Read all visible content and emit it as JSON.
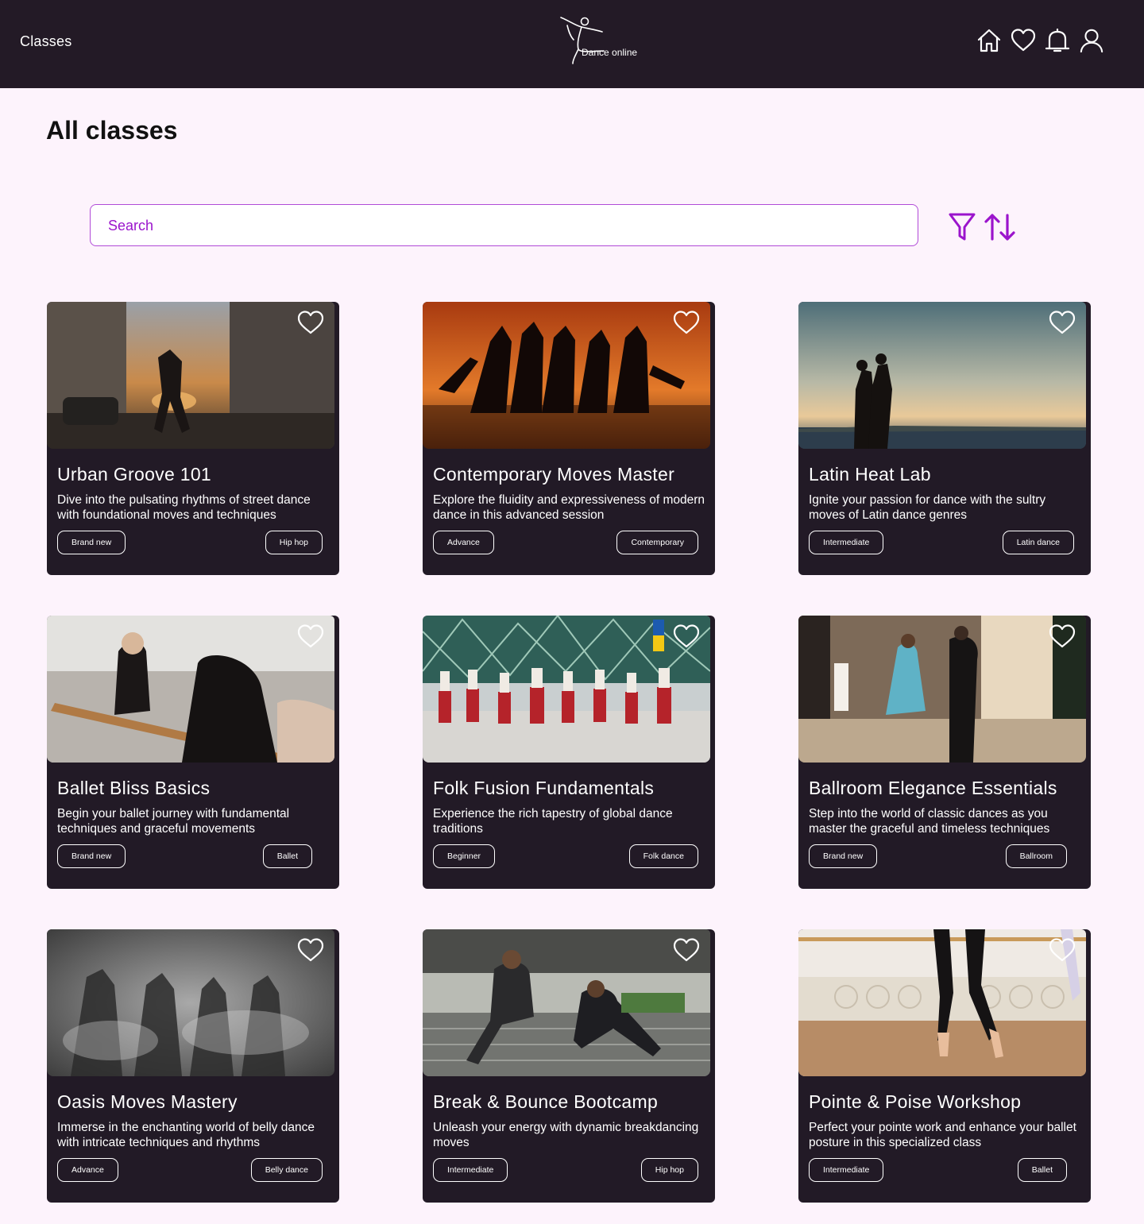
{
  "header": {
    "nav_title": "Classes",
    "brand": "Dance online",
    "icons": [
      "home-icon",
      "heart-icon",
      "bell-icon",
      "user-icon"
    ]
  },
  "page": {
    "title": "All classes"
  },
  "search": {
    "placeholder": "Search",
    "value": ""
  },
  "colors": {
    "topbar": "#231a26",
    "page_bg": "#fdf3fc",
    "card_bg": "#221a26",
    "accent": "#9b14cc"
  },
  "classes": [
    {
      "title": "Urban Groove 101",
      "description": "Dive into the pulsating rhythms of street dance with foundational moves and techniques",
      "level": "Brand new",
      "style": "Hip hop",
      "image": "street-dancer-city-sunset"
    },
    {
      "title": "Contemporary Moves Master",
      "description": "Explore the fluidity and expressiveness of modern dance in this advanced session",
      "level": "Advance",
      "style": "Contemporary",
      "image": "dancers-silhouette-orange"
    },
    {
      "title": "Latin Heat Lab",
      "description": "Ignite your passion for dance with the sultry moves of Latin dance genres",
      "level": "Intermediate",
      "style": "Latin dance",
      "image": "couple-dancing-waterfront"
    },
    {
      "title": "Ballet Bliss Basics",
      "description": "Begin your ballet journey with fundamental techniques and graceful movements",
      "level": "Brand new",
      "style": "Ballet",
      "image": "ballet-barre-class"
    },
    {
      "title": "Folk Fusion Fundamentals",
      "description": "Experience the rich tapestry of global dance traditions",
      "level": "Beginner",
      "style": "Folk dance",
      "image": "folk-dance-troupe"
    },
    {
      "title": "Ballroom Elegance Essentials",
      "description": "Step into the world of classic dances as you master the graceful and timeless techniques",
      "level": "Brand new",
      "style": "Ballroom",
      "image": "ballroom-couple"
    },
    {
      "title": "Oasis Moves Mastery",
      "description": "Immerse in the enchanting world of belly dance with intricate techniques and rhythms",
      "level": "Advance",
      "style": "Belly dance",
      "image": "belly-dancers-smoke"
    },
    {
      "title": "Break & Bounce Bootcamp",
      "description": "Unleash your energy with dynamic breakdancing moves",
      "level": "Intermediate",
      "style": "Hip hop",
      "image": "breakdancers-underpass"
    },
    {
      "title": "Pointe & Poise Workshop",
      "description": "Perfect your pointe work and enhance your ballet posture in this specialized class",
      "level": "Intermediate",
      "style": "Ballet",
      "image": "pointe-shoes-studio"
    }
  ]
}
